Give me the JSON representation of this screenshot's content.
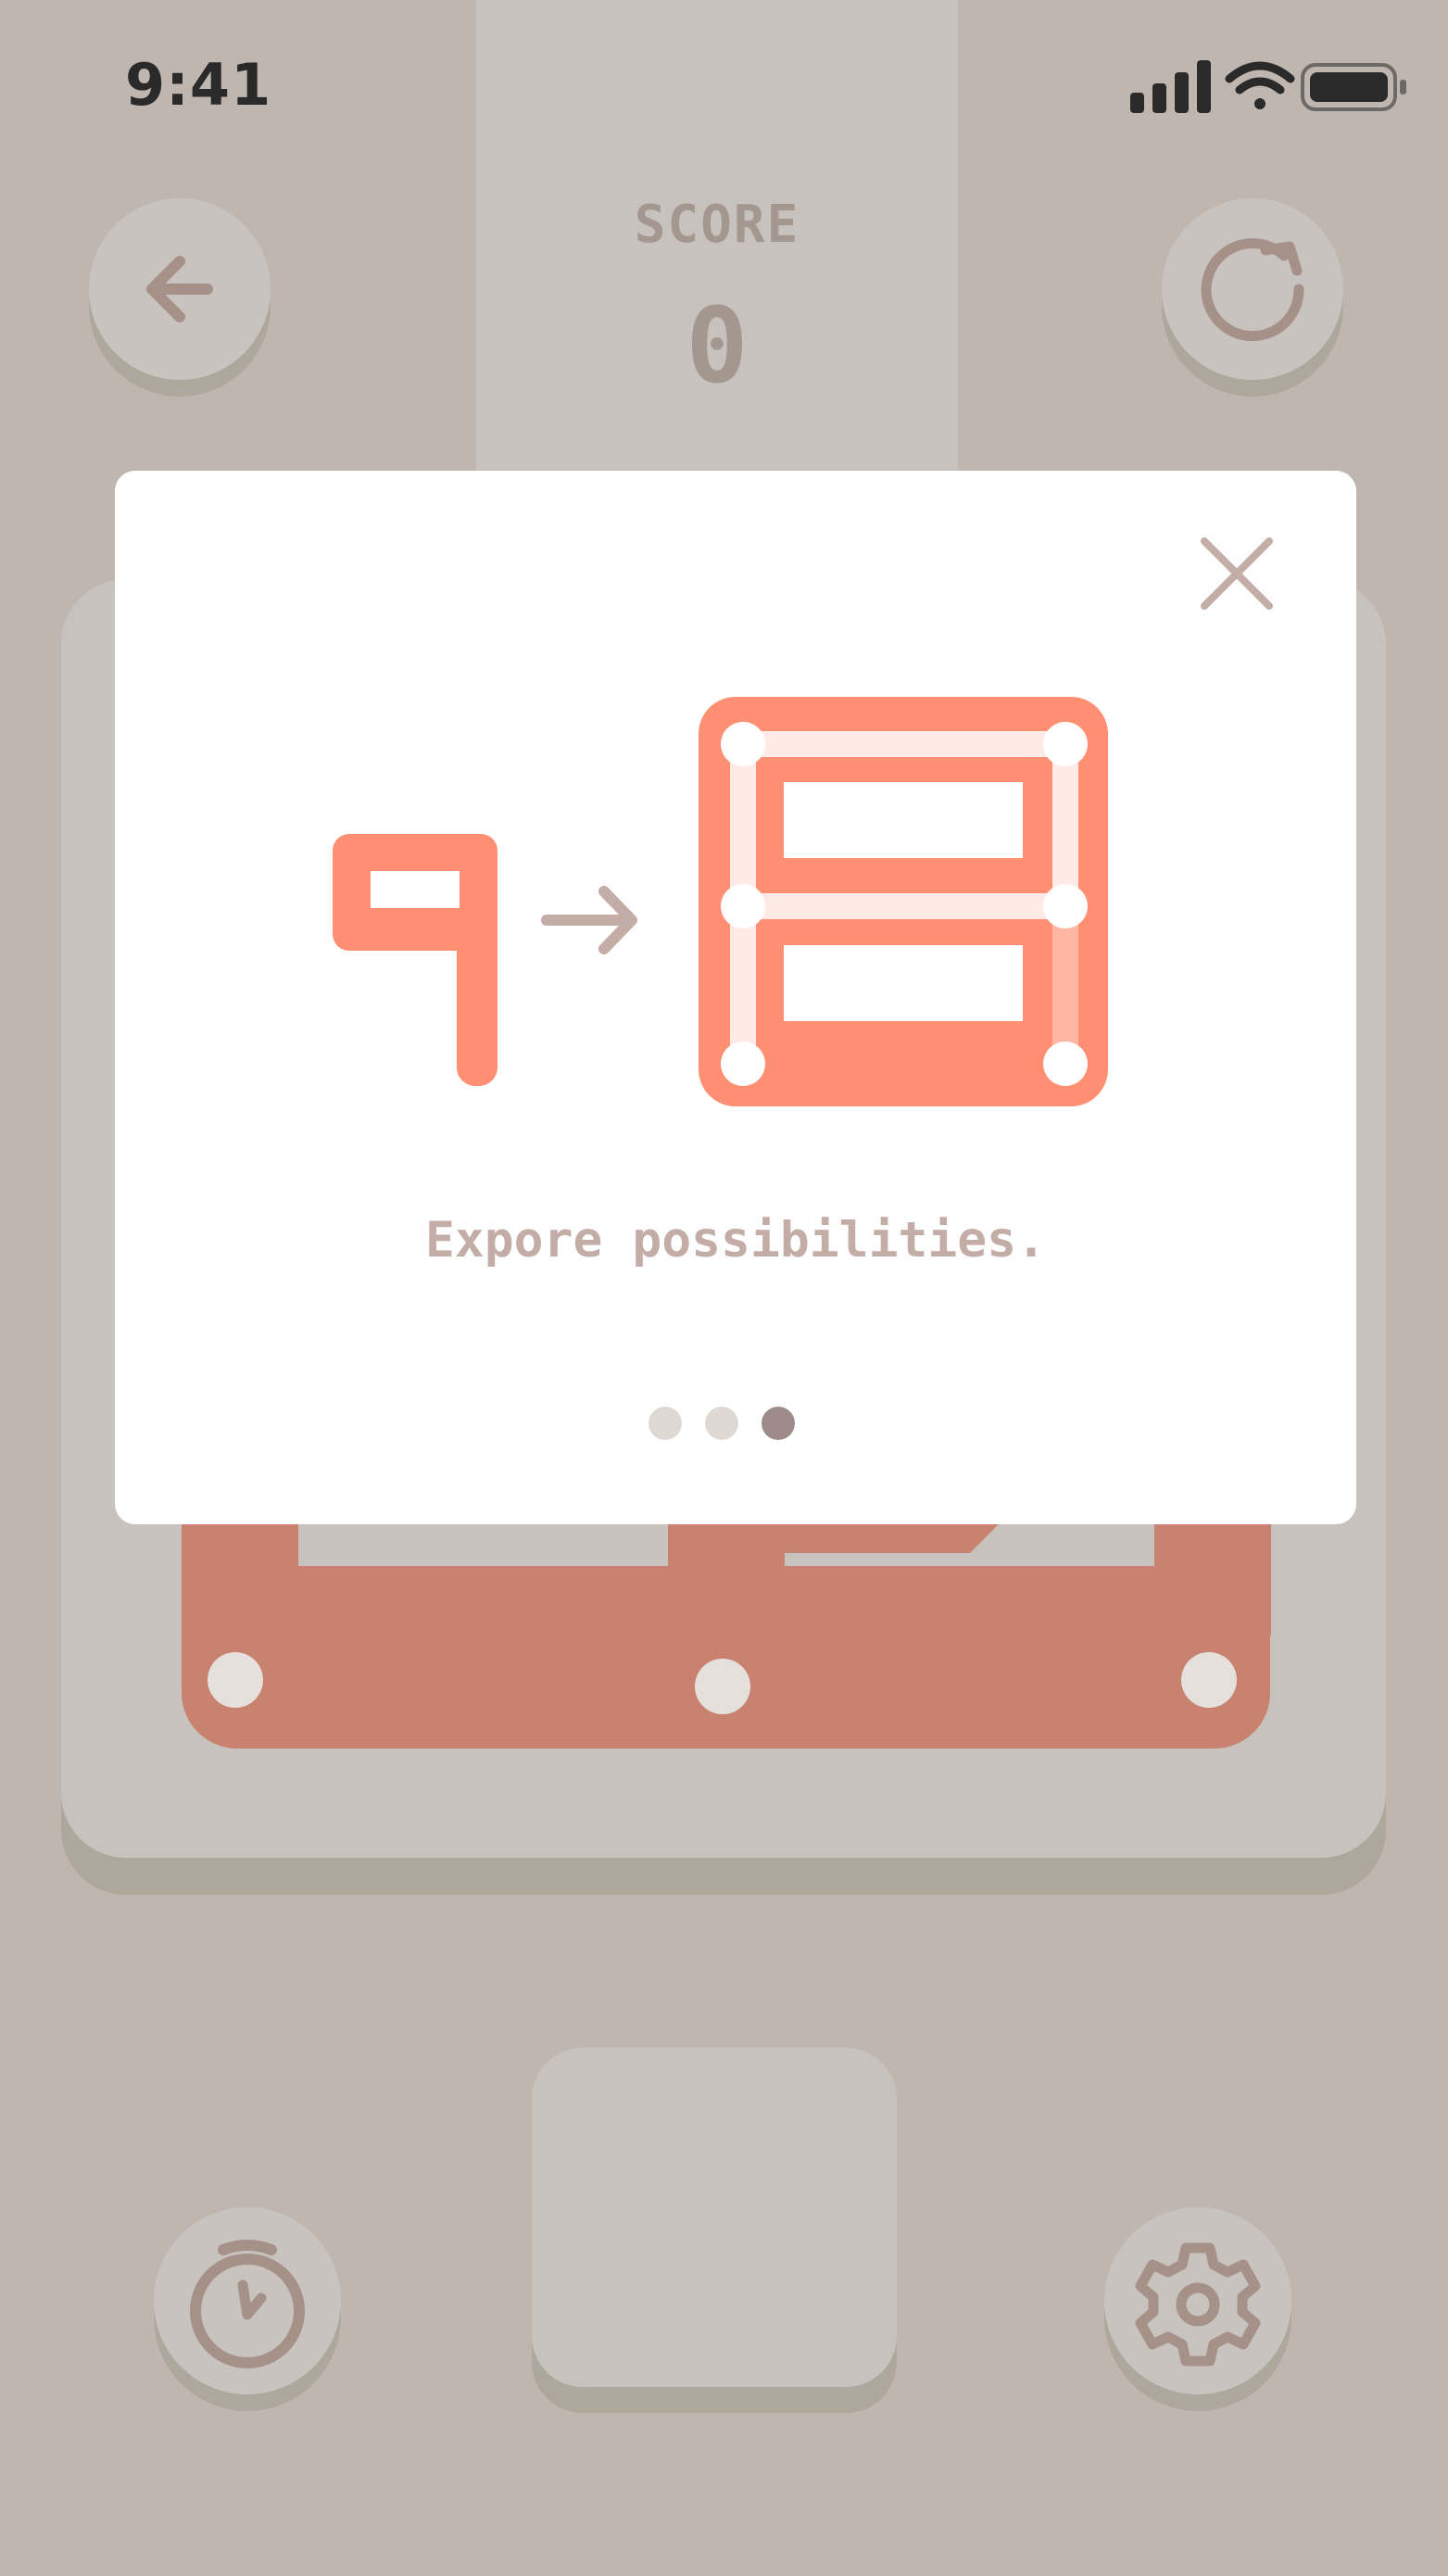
{
  "status_bar": {
    "time": "9:41"
  },
  "header": {
    "back_icon": "arrow-left-icon",
    "restart_icon": "restart-icon",
    "score_label": "SCORE",
    "score_value": "0"
  },
  "tutorial_modal": {
    "close_icon": "close-icon",
    "illustration": "digit-nine-to-eight-illustration",
    "text": "Expore possibilities.",
    "pagination": {
      "total": 3,
      "active_index": 2
    }
  },
  "footer": {
    "timer_icon": "stopwatch-icon",
    "settings_icon": "gear-icon"
  },
  "colors": {
    "background": "#c0b6b0",
    "accent": "#ff8f72",
    "board_piece": "#c8826f",
    "icon": "#a69189",
    "modal": "#ffffff"
  }
}
